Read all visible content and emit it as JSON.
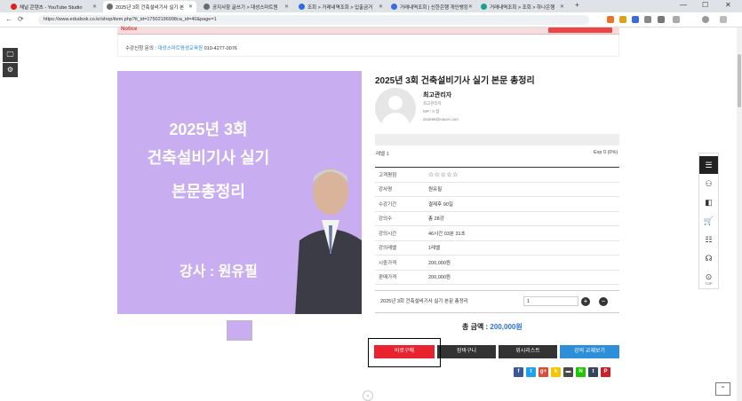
{
  "browser": {
    "tabs": [
      {
        "label": "채널 콘텐츠 - YouTube Studio",
        "color": "#e02020"
      },
      {
        "label": "2025년 3회 건축설비기사 실기 본",
        "color": "#6a6a6a"
      },
      {
        "label": "공지사항 글쓰기 > 대성스마트원",
        "color": "#6a6a6a"
      },
      {
        "label": "조회 > 거래내역조회 > 입출금거",
        "color": "#2a6fdb"
      },
      {
        "label": "거래내역조회 | 신한은행 개인뱅킹",
        "color": "#3b6bd9"
      },
      {
        "label": "거래내역조회 > 조회 > 하나은행",
        "color": "#1aa38a"
      }
    ],
    "new_tab": "+",
    "url": "https://www.edudsok.co.kr/shop/item.php?it_id=17502196998ca_id=40&page=1",
    "win_controls": [
      "—",
      "☐",
      "✕"
    ]
  },
  "notice": {
    "title": "Notice"
  },
  "contact": {
    "prefix": "수강신청 문의 : ",
    "link": "대성스마트평생교육원",
    "phone": " 010-4277-0076"
  },
  "product": {
    "title": "2025년 3회 건축설비기사 실기 본문 총정리",
    "banner": {
      "line1": "2025년 3회",
      "line2": "건축설비기사 실기",
      "line3": "본문총정리",
      "lecturer": "강사 : 원유필"
    }
  },
  "author": {
    "name": "최고관리자",
    "role": "최고관리자",
    "mp": "MP : 0 점",
    "email": "dsok99@naver.com",
    "level": "레벨 1",
    "exp": "Exp 0 (0%)",
    "exp_progress": 0
  },
  "info_rows": [
    {
      "key": "고객평점",
      "value": "☆☆☆☆☆"
    },
    {
      "key": "강사명",
      "value": "원유필"
    },
    {
      "key": "수강기간",
      "value": "결제후 90일"
    },
    {
      "key": "강의수",
      "value": "총 28강"
    },
    {
      "key": "강의시간",
      "value": "46시간 03분 31초"
    },
    {
      "key": "강의레벨",
      "value": "1레벨"
    },
    {
      "key": "시중가격",
      "value": "200,000원"
    },
    {
      "key": "판매가격",
      "value": "200,000원"
    }
  ],
  "option": {
    "name": "2025년 3회 건축설비기사 실기 본문 총정리",
    "quantity": "1",
    "plus": "+",
    "minus": "−"
  },
  "total": {
    "label": "총 금액 : ",
    "price": "200,000원"
  },
  "buttons": {
    "buy": "바로구매",
    "cart": "장바구니",
    "wish": "위시리스트",
    "textbook": "강의 교재보기"
  },
  "social": [
    "f",
    "t",
    "g+",
    "k",
    "▬",
    "N",
    "t",
    "P"
  ],
  "quick_menu": [
    "☰",
    "⚇",
    "◧",
    "🛒",
    "☷",
    "☊",
    "⊙"
  ],
  "top_label": "TOP",
  "colors": {
    "buy": "#e8232f",
    "dark": "#333333",
    "accent": "#2e8fd8",
    "banner": "#c8aef0"
  }
}
